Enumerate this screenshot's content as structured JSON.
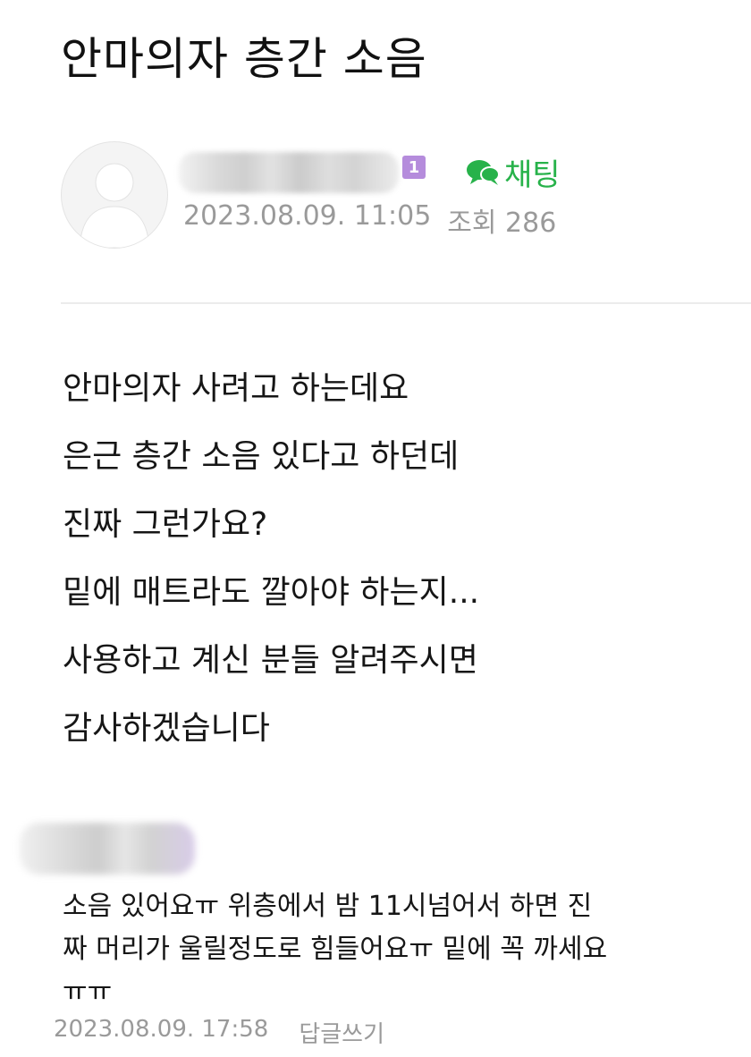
{
  "post": {
    "title": "안마의자 층간 소음",
    "level_badge": "1",
    "chat_label": "채팅",
    "date": "2023.08.09. 11:05",
    "views": "조회 286",
    "body_lines": [
      "안마의자 사려고 하는데요",
      "은근 층간 소음 있다고 하던데",
      "진짜 그런가요?",
      "밑에 매트라도 깔아야 하는지...",
      "사용하고 계신 분들 알려주시면",
      "감사하겠습니다"
    ]
  },
  "comment": {
    "lines": [
      "소음 있어요ㅠ 위층에서 밤 11시넘어서 하면 진",
      "짜 머리가 울릴정도로 힘들어요ㅠ 밑에 꼭 까세요",
      "ㅠㅠ"
    ],
    "date": "2023.08.09. 17:58",
    "reply_label": "답글쓰기"
  },
  "icons": {
    "avatar": "default-profile-icon",
    "chat": "chat-bubble-icon"
  },
  "colors": {
    "chat_green": "#27b24a",
    "badge_purple": "#b58cdc",
    "meta_gray": "#9a9a9a"
  }
}
